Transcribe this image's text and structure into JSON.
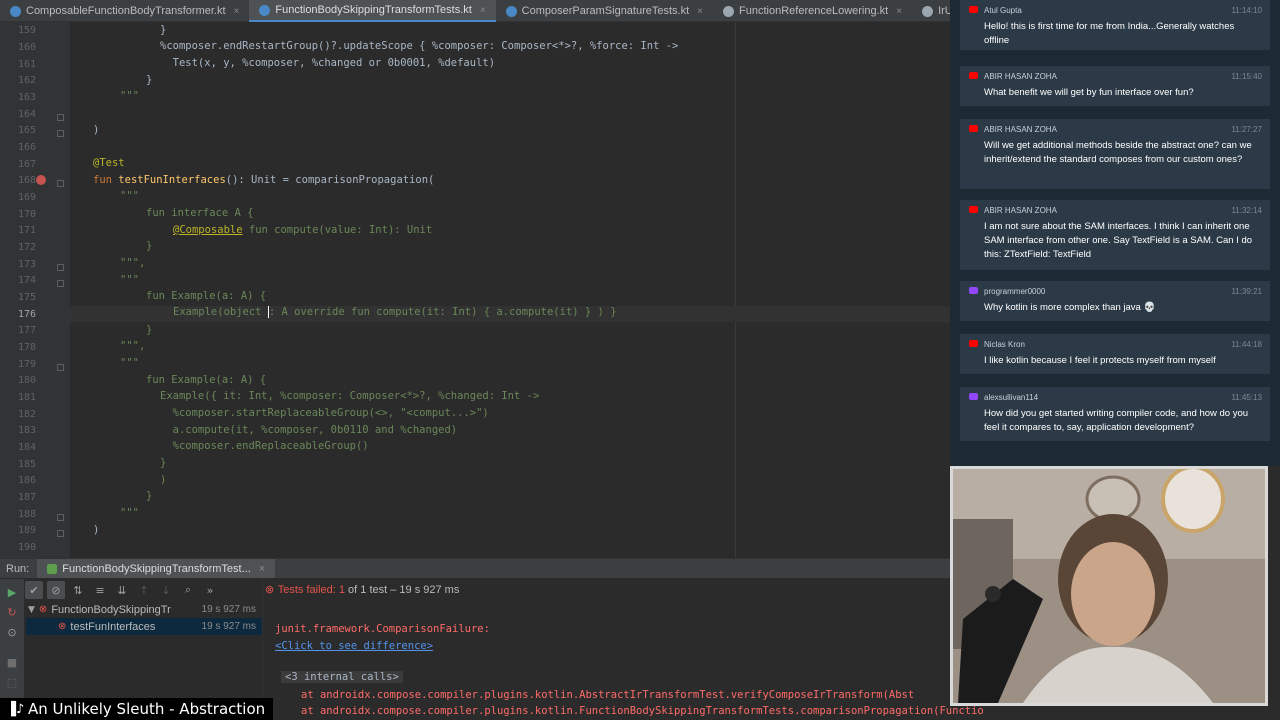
{
  "tabs": [
    {
      "label": "ComposableFunctionBodyTransformer.kt",
      "icon_color": "#4a88c7"
    },
    {
      "label": "FunctionBodySkippingTransformTests.kt",
      "icon_color": "#4a88c7"
    },
    {
      "label": "ComposerParamSignatureTests.kt",
      "icon_color": "#4a88c7"
    },
    {
      "label": "FunctionReferenceLowering.kt",
      "icon_color": "#9aa7b0"
    },
    {
      "label": "IrUtils.kt",
      "icon_color": "#9aa7b0"
    }
  ],
  "tab_close_glyph": "×",
  "editor": {
    "line_numbers": [
      "159",
      "160",
      "161",
      "162",
      "163",
      "164",
      "165",
      "166",
      "167",
      "168",
      "169",
      "170",
      "171",
      "172",
      "173",
      "174",
      "175",
      "176",
      "177",
      "178",
      "179",
      "180",
      "181",
      "182",
      "183",
      "184",
      "185",
      "186",
      "187",
      "188",
      "189",
      "190"
    ],
    "code": {
      "l159": "}",
      "l160": "%composer.endRestartGroup()?.updateScope { %composer: Composer<*>?, %force: Int ->",
      "l161": "  Test(x, y, %composer, %changed or 0b0001, %default)",
      "l162": "}",
      "l163": "\"\"\"",
      "l165": ")",
      "l167": "@Test",
      "l168_kw": "fun ",
      "l168_fn": "testFunInterfaces",
      "l168_rest": "(): Unit = comparisonPropagation(",
      "l169": "\"\"\"",
      "l170": "fun interface A {",
      "l171_ann": "@Composable",
      "l171_rest": " fun compute(value: Int): Unit",
      "l172": "}",
      "l173": "\"\"\",",
      "l174": "\"\"\"",
      "l175": "fun Example(a: A) {",
      "l176_pre": "Example(object ",
      "l176_post": ": A override fun compute(it: Int) { a.compute(it) } ) }",
      "l177": "}",
      "l178": "\"\"\",",
      "l179": "\"\"\"",
      "l180": "fun Example(a: A) {",
      "l181": "Example({ it: Int, %composer: Composer<*>?, %changed: Int ->",
      "l182": "  %composer.startReplaceableGroup(<>, \"<comput...>\")",
      "l183": "  a.compute(it, %composer, 0b0110 and %changed)",
      "l184": "  %composer.endReplaceableGroup()",
      "l185": "}",
      "l186": ")",
      "l187": "}",
      "l188": "\"\"\"",
      "l189": ")"
    }
  },
  "run": {
    "label": "Run:",
    "tab": "FunctionBodySkippingTransformTest...",
    "status_failed": "Tests failed: 1",
    "status_rest": " of 1 test – 19 s 927 ms",
    "tree": [
      {
        "label": "FunctionBodySkippingTr",
        "time": "19 s 927 ms"
      },
      {
        "label": "testFunInterfaces",
        "time": "19 s 927 ms"
      }
    ],
    "output": {
      "error": "junit.framework.ComparisonFailure:",
      "link": "<Click to see difference>",
      "folded": "<3 internal calls>",
      "stack1": "at androidx.compose.compiler.plugins.kotlin.AbstractIrTransformTest.verifyComposeIrTransform(Abst",
      "stack2": "at androidx.compose.compiler.plugins.kotlin.FunctionBodySkippingTransformTests.comparisonPropagation(Functio"
    }
  },
  "chat": [
    {
      "author": "Atul Gupta",
      "time": "11:14:10",
      "platform": "youtube",
      "text": "Hello! this is first time for me from India...Generally watches offline"
    },
    {
      "author": "ABIR HASAN ZOHA",
      "time": "11:15:40",
      "platform": "youtube",
      "text": "What benefit we will get by fun interface over fun?"
    },
    {
      "author": "ABIR HASAN ZOHA",
      "time": "11:27:27",
      "platform": "youtube",
      "text": "Will we get additional methods beside the abstract one? can we inherit/extend the standard composes from our custom ones?"
    },
    {
      "author": "ABIR HASAN ZOHA",
      "time": "11:32:14",
      "platform": "youtube",
      "text": "I am not sure about the SAM interfaces. I think I can inherit one SAM interface from other one. Say TextField is a SAM. Can I do this: ZTextField: TextField"
    },
    {
      "author": "programmer0000",
      "time": "11:39:21",
      "platform": "twitch",
      "text": "Why kotlin is more complex than java 💀"
    },
    {
      "author": "Niclas Kron",
      "time": "11:44:18",
      "platform": "youtube",
      "text": "I like kotlin because I feel it protects myself from myself"
    },
    {
      "author": "alexsullivan114",
      "time": "11:45:13",
      "platform": "twitch",
      "text": "How did you get started writing compiler code, and how do you feel it compares to, say, application development?"
    }
  ],
  "colors": {
    "youtube": "#ff0000",
    "twitch": "#9146ff",
    "fail": "#e5534b"
  },
  "caption": {
    "text": "An Unlikely Sleuth - Abstraction",
    "icon": "music-note-icon"
  }
}
